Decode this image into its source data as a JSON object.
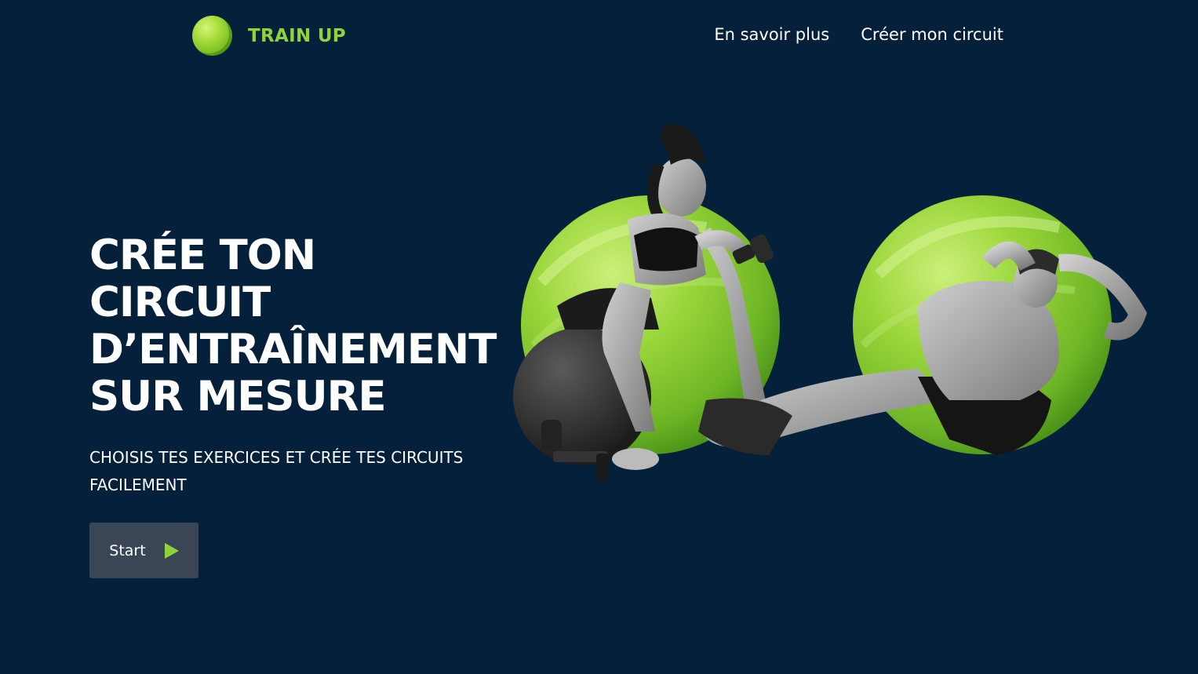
{
  "header": {
    "brand": "TRAIN UP",
    "nav": [
      "En savoir plus",
      "Créer mon circuit"
    ]
  },
  "hero": {
    "title_lines": [
      "CRÉE TON",
      "CIRCUIT",
      "D’ENTRAÎNEMENT",
      "SUR MESURE"
    ],
    "subtitle": "CHOISIS TES EXERCICES ET CRÉE TES CIRCUITS FACILEMENT",
    "cta_label": "Start"
  },
  "icons": {
    "logo": "green-ball-icon",
    "cta": "play-icon"
  },
  "colors": {
    "background": "#04203a",
    "accent": "#8fd33a",
    "button": "#3a4656",
    "text": "#ffffff"
  }
}
